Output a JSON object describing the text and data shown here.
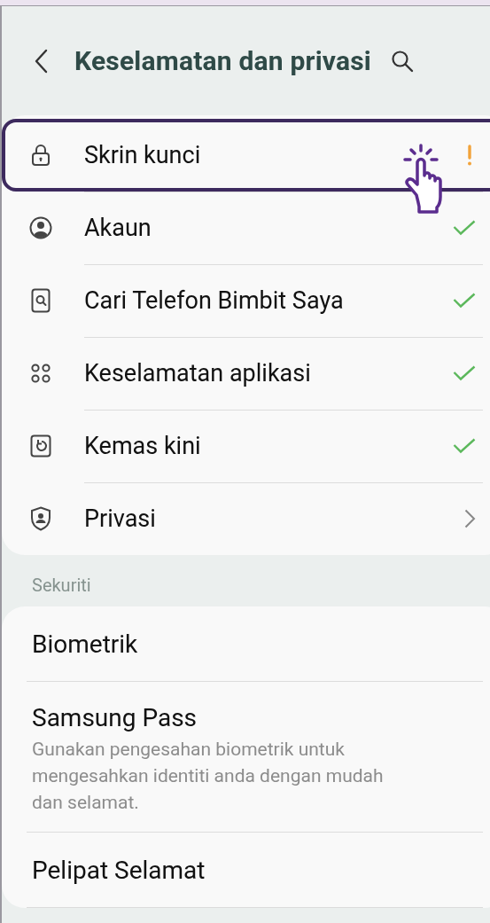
{
  "header": {
    "title": "Keselamatan dan privasi"
  },
  "main_items": [
    {
      "label": "Skrin kunci",
      "kind": "warning",
      "highlighted": true
    },
    {
      "label": "Akaun",
      "kind": "checked",
      "highlighted": false
    },
    {
      "label": "Cari Telefon Bimbit Saya",
      "kind": "checked",
      "highlighted": false
    },
    {
      "label": "Keselamatan aplikasi",
      "kind": "checked",
      "highlighted": false
    },
    {
      "label": "Kemas kini",
      "kind": "checked",
      "highlighted": false
    },
    {
      "label": "Privasi",
      "kind": "link",
      "highlighted": false
    }
  ],
  "security_section": {
    "heading": "Sekuriti",
    "items": [
      {
        "label": "Biometrik"
      },
      {
        "label": "Samsung Pass",
        "description": "Gunakan pengesahan biometrik untuk mengesahkan identiti anda dengan mudah dan selamat."
      },
      {
        "label": "Pelipat Selamat"
      }
    ]
  }
}
